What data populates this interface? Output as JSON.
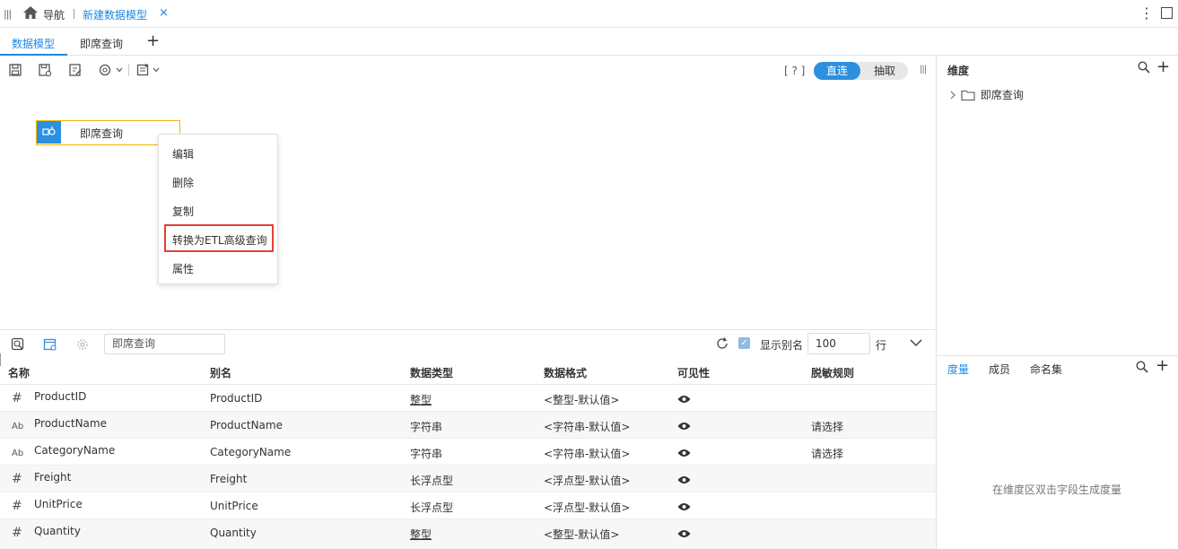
{
  "topbar": {
    "nav_label": "导航",
    "tab_title": "新建数据模型",
    "tab_close": "×"
  },
  "subtabs": [
    {
      "label": "数据模型",
      "active": true
    },
    {
      "label": "即席查询",
      "active": false
    }
  ],
  "toolbar": {
    "help": "[ ? ]",
    "mode_on": "直连",
    "mode_off": "抽取"
  },
  "canvas": {
    "node_label": "即席查询",
    "context_menu": [
      "编辑",
      "删除",
      "复制",
      "转换为ETL高级查询",
      "属性"
    ]
  },
  "right_panel": {
    "title": "维度",
    "tree_item": "即席查询",
    "tabs": [
      "度量",
      "成员",
      "命名集"
    ],
    "empty_hint": "在维度区双击字段生成度量"
  },
  "bottom_toolbar": {
    "source_name": "即席查询",
    "show_alias_label": "显示别名",
    "row_count": "100",
    "row_unit": "行"
  },
  "table": {
    "headers": [
      "名称",
      "别名",
      "数据类型",
      "数据格式",
      "可见性",
      "脱敏规则"
    ],
    "rows": [
      {
        "icon": "#",
        "name": "ProductID",
        "alias": "ProductID",
        "type": "整型",
        "format": "<整型-默认值>",
        "mask": ""
      },
      {
        "icon": "Ab",
        "name": "ProductName",
        "alias": "ProductName",
        "type": "字符串",
        "format": "<字符串-默认值>",
        "mask": "请选择"
      },
      {
        "icon": "Ab",
        "name": "CategoryName",
        "alias": "CategoryName",
        "type": "字符串",
        "format": "<字符串-默认值>",
        "mask": "请选择"
      },
      {
        "icon": "#",
        "name": "Freight",
        "alias": "Freight",
        "type": "长浮点型",
        "format": "<浮点型-默认值>",
        "mask": ""
      },
      {
        "icon": "#",
        "name": "UnitPrice",
        "alias": "UnitPrice",
        "type": "长浮点型",
        "format": "<浮点型-默认值>",
        "mask": ""
      },
      {
        "icon": "#",
        "name": "Quantity",
        "alias": "Quantity",
        "type": "整型",
        "format": "<整型-默认值>",
        "mask": ""
      }
    ]
  }
}
